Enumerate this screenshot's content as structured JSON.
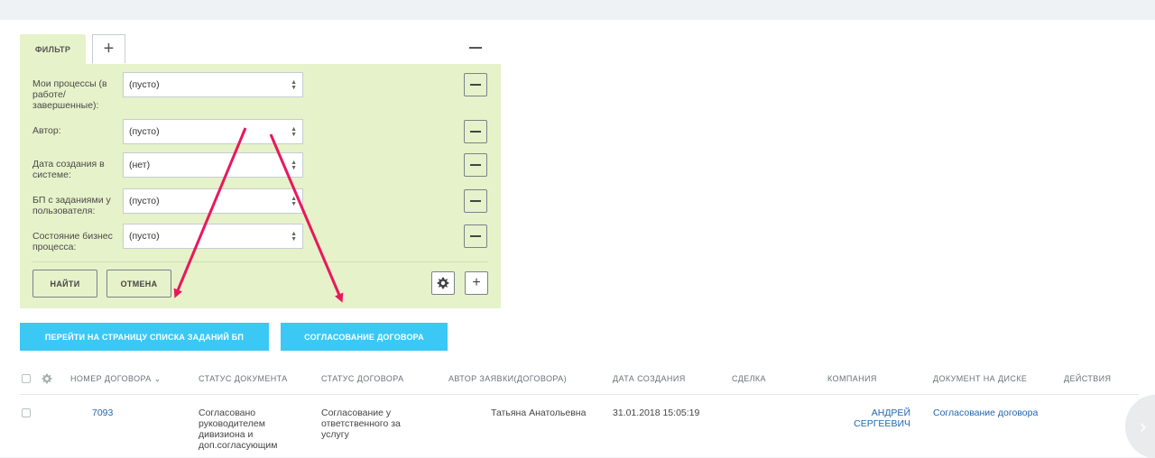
{
  "filter": {
    "tab_label": "ФИЛЬТР",
    "add_tab_label": "+",
    "rows": [
      {
        "label": "Мои процессы (в работе/ завершенные):",
        "value": "(пусто)"
      },
      {
        "label": "Автор:",
        "value": "(пусто)"
      },
      {
        "label": "Дата создания в системе:",
        "value": "(нет)"
      },
      {
        "label": "БП с заданиями у пользователя:",
        "value": "(пусто)"
      },
      {
        "label": "Состояние бизнес процесса:",
        "value": "(пусто)"
      }
    ],
    "find_label": "НАЙТИ",
    "cancel_label": "ОТМЕНА",
    "add_field_label": "+"
  },
  "actions": {
    "goto_tasks_label": "ПЕРЕЙТИ НА СТРАНИЦУ СПИСКА ЗАДАНИЙ БП",
    "contract_approval_label": "СОГЛАСОВАНИЕ ДОГОВОРА"
  },
  "table": {
    "columns": [
      "НОМЕР ДОГОВОРА",
      "СТАТУС ДОКУМЕНТА",
      "СТАТУС ДОГОВОРА",
      "АВТОР ЗАЯВКИ(ДОГОВОРА)",
      "ДАТА СОЗДАНИЯ",
      "СДЕЛКА",
      "КОМПАНИЯ",
      "ДОКУМЕНТ НА ДИСКЕ",
      "ДЕЙСТВИЯ"
    ],
    "sort_indicator": "⌄",
    "rows": [
      {
        "number": "7093",
        "doc_status": "Согласовано руководителем дивизиона и доп.согласующим",
        "contract_status": "Согласование у ответственного за услугу",
        "author": "Татьяна Анатольевна",
        "created": "31.01.2018 15:05:19",
        "deal": "",
        "company": "АНДРЕЙ СЕРГЕЕВИЧ",
        "disk_document": "Согласование договора"
      }
    ]
  },
  "colors": {
    "filter_bg": "#e6f2c9",
    "primary_button": "#3bc8f5",
    "annotation_arrow": "#e8185c",
    "link": "#2067b0"
  }
}
